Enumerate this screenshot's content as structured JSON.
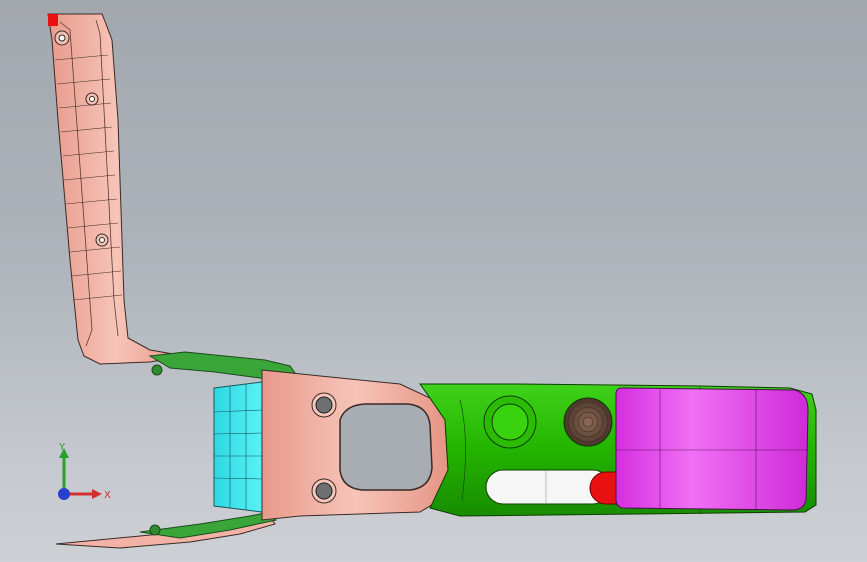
{
  "viewport": {
    "background_top": "#a3a7ae",
    "background_bottom": "#cdd0d5"
  },
  "model": {
    "parts": [
      {
        "name": "left-arm-panel",
        "color": "#f2b3a6"
      },
      {
        "name": "upper-bracket",
        "color": "#2e9e2e"
      },
      {
        "name": "lower-bracket",
        "color": "#2e9e2e"
      },
      {
        "name": "front-block",
        "color": "#35e8ee"
      },
      {
        "name": "front-frame",
        "color": "#f2b3a6"
      },
      {
        "name": "console-body",
        "color": "#2ab800"
      },
      {
        "name": "storage-lid",
        "color": "#e33bea"
      },
      {
        "name": "speaker-grille",
        "color": "#6b4d3c"
      },
      {
        "name": "red-marker",
        "color": "#e81010"
      }
    ]
  },
  "triad": {
    "x_label": "X",
    "y_label": "Y",
    "x_color": "#d23030",
    "y_color": "#2aa12a",
    "z_color": "#2a3fd0"
  }
}
